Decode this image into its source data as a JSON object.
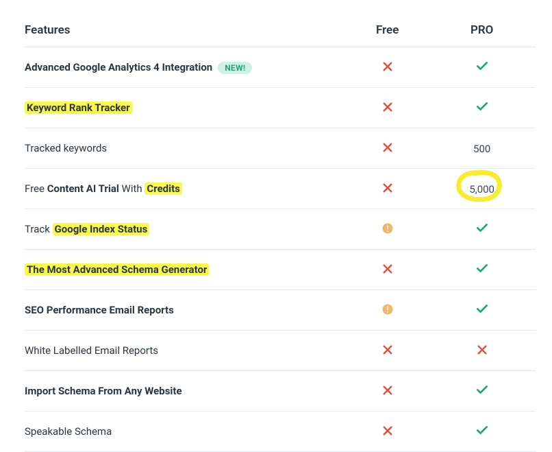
{
  "header": {
    "features": "Features",
    "free": "Free",
    "pro": "PRO"
  },
  "badge_new": "NEW!",
  "rows": [
    {
      "label_parts": [
        {
          "t": "Advanced Google Analytics 4 Integration",
          "b": true
        }
      ],
      "new_badge": true,
      "free": "cross",
      "pro": "check"
    },
    {
      "label_parts": [
        {
          "t": "Keyword Rank Tracker",
          "b": true,
          "hl": true
        }
      ],
      "free": "cross",
      "pro": "check"
    },
    {
      "label_parts": [
        {
          "t": "Tracked keywords"
        }
      ],
      "free": "cross",
      "pro": "500"
    },
    {
      "label_parts": [
        {
          "t": "Free "
        },
        {
          "t": "Content AI Trial",
          "b": true
        },
        {
          "t": " With "
        },
        {
          "t": "Credits",
          "b": true,
          "hl": true
        }
      ],
      "free": "cross",
      "pro": "5,000",
      "circle_pro": true
    },
    {
      "label_parts": [
        {
          "t": "Track "
        },
        {
          "t": "Google Index Status",
          "b": true,
          "hl": true
        }
      ],
      "free": "warn",
      "pro": "check"
    },
    {
      "label_parts": [
        {
          "t": "The Most Advanced Schema Generator",
          "b": true,
          "hl": true
        }
      ],
      "free": "cross",
      "pro": "check"
    },
    {
      "label_parts": [
        {
          "t": "SEO Performance Email Reports",
          "b": true
        }
      ],
      "free": "warn",
      "pro": "check"
    },
    {
      "label_parts": [
        {
          "t": "White Labelled Email Reports"
        }
      ],
      "free": "cross",
      "pro": "cross"
    },
    {
      "label_parts": [
        {
          "t": "Import Schema From Any Website",
          "b": true
        }
      ],
      "free": "cross",
      "pro": "check"
    },
    {
      "label_parts": [
        {
          "t": "Speakable Schema"
        }
      ],
      "free": "cross",
      "pro": "check"
    }
  ]
}
